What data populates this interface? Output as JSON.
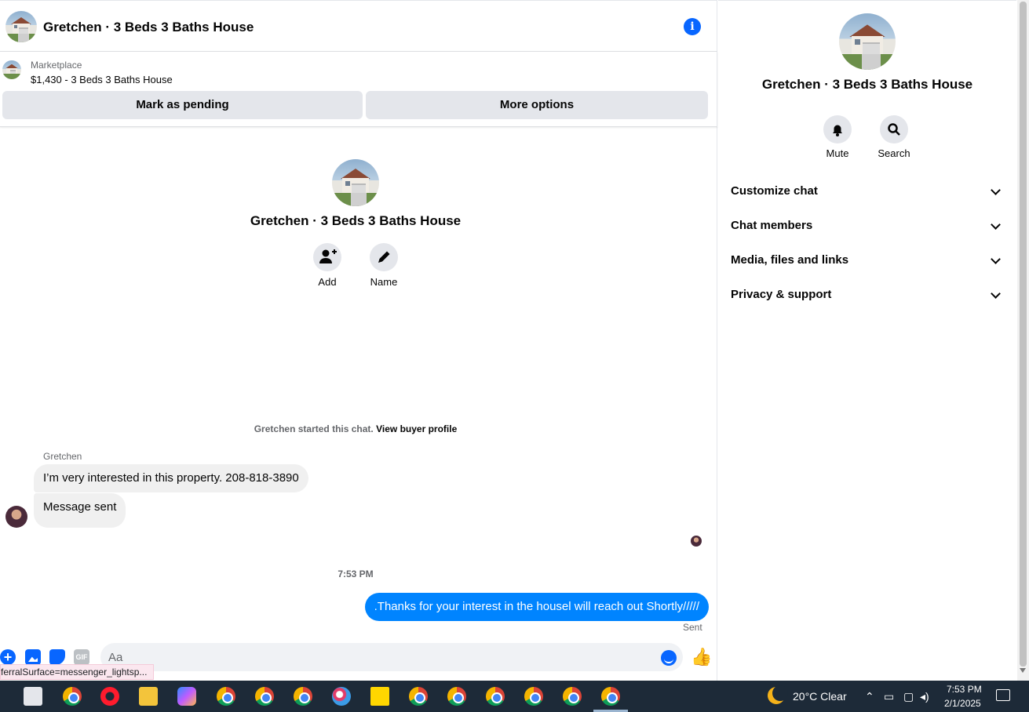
{
  "header": {
    "title": "Gretchen · 3 Beds 3 Baths House",
    "info_icon": "info-icon"
  },
  "listing": {
    "source_label": "Marketplace",
    "item": "$1,430 - 3 Beds 3 Baths House",
    "pending_label": "Mark as pending",
    "more_label": "More options"
  },
  "intro": {
    "title": "Gretchen · 3 Beds 3 Baths House",
    "add_label": "Add",
    "name_label": "Name",
    "started_text": "Gretchen started this chat.",
    "view_profile_label": "View buyer profile"
  },
  "messages": {
    "sender": "Gretchen",
    "incoming": [
      "I’m very interested in this property. 208-818-3890",
      "Message sent"
    ],
    "time_divider": "7:53 PM",
    "outgoing": ".Thanks for your interest in the housel will reach out Shortly/////",
    "status": "Sent"
  },
  "composer": {
    "placeholder": "Aa",
    "gif_label": "GIF",
    "plus_symbol": "+",
    "like_symbol": "👍"
  },
  "tooltip": {
    "url_fragment": "ferralSurface=messenger_lightsp..."
  },
  "side": {
    "title": "Gretchen · 3 Beds 3 Baths House",
    "mute_label": "Mute",
    "search_label": "Search",
    "sections": [
      "Customize chat",
      "Chat members",
      "Media, files and links",
      "Privacy & support"
    ]
  },
  "taskbar": {
    "weather": "20°C  Clear",
    "time": "7:53 PM",
    "date": "2/1/2025",
    "tray_icons": [
      "chevron-up-icon",
      "network-icon",
      "meet-icon",
      "volume-icon"
    ],
    "apps": [
      "settings-icon",
      "chrome-icon",
      "opera-icon",
      "file-explorer-icon",
      "copilot-icon",
      "chrome-icon",
      "chrome-icon",
      "chrome-icon",
      "paint-icon",
      "sticky-notes-icon",
      "chrome-icon",
      "chrome-icon",
      "chrome-icon",
      "chrome-icon",
      "chrome-icon",
      "chrome-icon"
    ]
  },
  "colors": {
    "accent": "#0866ff",
    "outgoing_bubble": "#0084ff",
    "incoming_bubble": "#f0f0f0",
    "taskbar": "#1d2a38"
  }
}
